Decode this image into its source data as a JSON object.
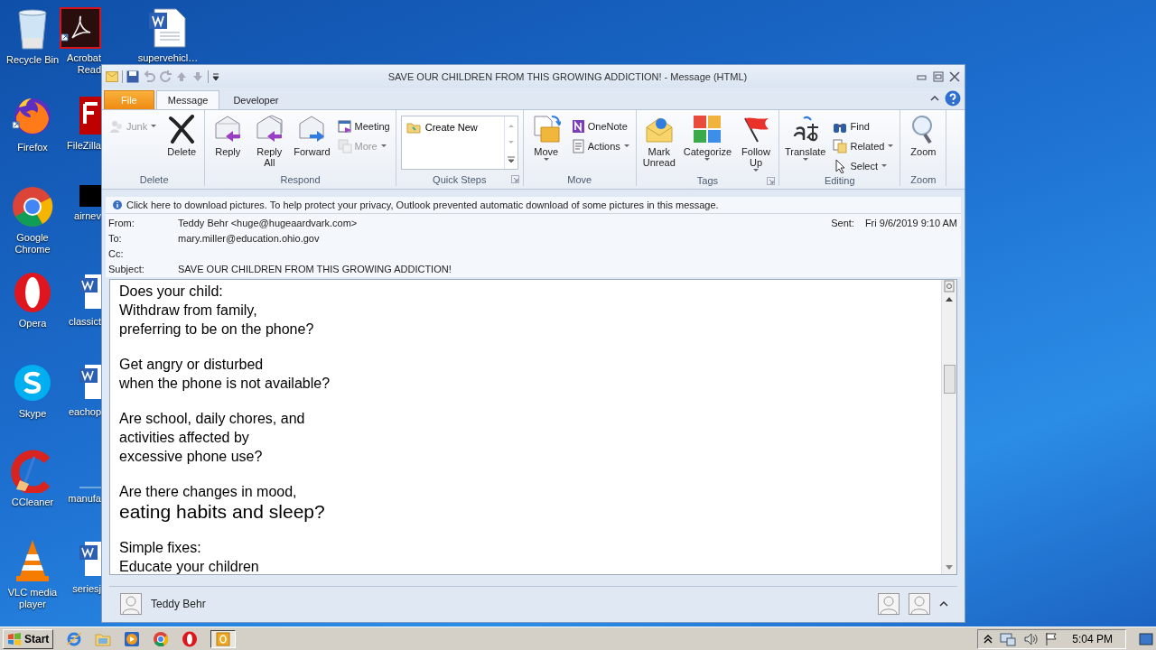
{
  "desktop_icons": [
    {
      "label": "Recycle Bin"
    },
    {
      "label": "Acrobat Read"
    },
    {
      "label": "supervehicl…"
    },
    {
      "label": "Firefox"
    },
    {
      "label": "FileZilla"
    },
    {
      "label": "Google Chrome"
    },
    {
      "label": "airnev"
    },
    {
      "label": "Opera"
    },
    {
      "label": "classict"
    },
    {
      "label": "Skype"
    },
    {
      "label": "eachop"
    },
    {
      "label": "CCleaner"
    },
    {
      "label": "manufa"
    },
    {
      "label": "VLC media player"
    },
    {
      "label": "seriesj"
    }
  ],
  "window": {
    "title": "SAVE OUR CHILDREN FROM THIS GROWING ADDICTION! - Message (HTML)"
  },
  "tabs": [
    {
      "label": "File",
      "kind": "file",
      "selected": false
    },
    {
      "label": "Message",
      "kind": "tab",
      "selected": true
    },
    {
      "label": "Developer",
      "kind": "tab",
      "selected": false
    }
  ],
  "ribbon": {
    "groups": [
      {
        "label": "Delete",
        "launcher": false,
        "buttons": [
          {
            "label": "Junk",
            "kind": "small",
            "disabled": true,
            "dropdown": true
          },
          {
            "label": "Delete",
            "kind": "large",
            "disabled": false,
            "dropdown": false
          }
        ]
      },
      {
        "label": "Respond",
        "launcher": false,
        "buttons": [
          {
            "label": "Reply",
            "kind": "large",
            "disabled": false,
            "dropdown": false
          },
          {
            "label": "Reply All",
            "kind": "large",
            "disabled": false,
            "dropdown": false
          },
          {
            "label": "Forward",
            "kind": "large",
            "disabled": false,
            "dropdown": false
          },
          {
            "label": "Meeting",
            "kind": "small",
            "disabled": false,
            "dropdown": false
          },
          {
            "label": "More",
            "kind": "small",
            "disabled": true,
            "dropdown": true
          }
        ]
      },
      {
        "label": "Quick Steps",
        "launcher": true,
        "buttons": [
          {
            "label": "Create New",
            "kind": "gallery",
            "disabled": false,
            "dropdown": false
          }
        ]
      },
      {
        "label": "Move",
        "launcher": false,
        "buttons": [
          {
            "label": "Move",
            "kind": "large",
            "disabled": false,
            "dropdown": true
          },
          {
            "label": "OneNote",
            "kind": "small",
            "disabled": false,
            "dropdown": false
          },
          {
            "label": "Actions",
            "kind": "small",
            "disabled": false,
            "dropdown": true
          }
        ]
      },
      {
        "label": "Tags",
        "launcher": true,
        "buttons": [
          {
            "label": "Mark Unread",
            "kind": "large",
            "disabled": false,
            "dropdown": false
          },
          {
            "label": "Categorize",
            "kind": "large",
            "disabled": false,
            "dropdown": true
          },
          {
            "label": "Follow Up",
            "kind": "large",
            "disabled": false,
            "dropdown": true
          }
        ]
      },
      {
        "label": "Editing",
        "launcher": false,
        "buttons": [
          {
            "label": "Translate",
            "kind": "large",
            "disabled": false,
            "dropdown": true
          },
          {
            "label": "Find",
            "kind": "small",
            "disabled": false,
            "dropdown": false
          },
          {
            "label": "Related",
            "kind": "small",
            "disabled": false,
            "dropdown": true
          },
          {
            "label": "Select",
            "kind": "small",
            "disabled": false,
            "dropdown": true
          }
        ]
      },
      {
        "label": "Zoom",
        "launcher": false,
        "buttons": [
          {
            "label": "Zoom",
            "kind": "large",
            "disabled": false,
            "dropdown": false
          }
        ]
      }
    ]
  },
  "info_bar": "Click here to download pictures. To help protect your privacy, Outlook prevented automatic download of some pictures in this message.",
  "header": {
    "fields": [
      {
        "label": "From:",
        "value": "Teddy Behr <huge@hugeaardvark.com>"
      },
      {
        "label": "To:",
        "value": "mary.miller@education.ohio.gov"
      },
      {
        "label": "Cc:"
      },
      {
        "label": "Subject:",
        "value": "SAVE OUR CHILDREN FROM THIS GROWING ADDICTION!"
      }
    ],
    "sent_label": "Sent:",
    "sent": "Fri 9/6/2019 9:10 AM"
  },
  "body": [
    {
      "lines": [
        {
          "text": "Does your child:",
          "kind": "normal"
        },
        {
          "text": "Withdraw from family,",
          "kind": "normal"
        },
        {
          "text": "preferring to be on the phone?",
          "kind": "normal"
        }
      ]
    },
    {
      "lines": [
        {
          "text": "Get angry or disturbed",
          "kind": "normal"
        },
        {
          "text": "when the phone is not available?",
          "kind": "normal"
        }
      ]
    },
    {
      "lines": [
        {
          "text": "Are school, daily chores, and",
          "kind": "normal"
        },
        {
          "text": "activities affected by",
          "kind": "normal"
        },
        {
          "text": "excessive phone use?",
          "kind": "normal"
        }
      ]
    },
    {
      "lines": [
        {
          "text": "Are there changes in mood,",
          "kind": "normal"
        },
        {
          "text": "eating habits and sleep?",
          "kind": "large"
        }
      ]
    },
    {
      "lines": [
        {
          "text": "Simple fixes:",
          "kind": "normal"
        },
        {
          "text": "Educate your children",
          "kind": "normal"
        }
      ]
    }
  ],
  "people_pane": {
    "name": "Teddy Behr"
  },
  "taskbar": {
    "start": "Start",
    "clock": "5:04 PM"
  }
}
